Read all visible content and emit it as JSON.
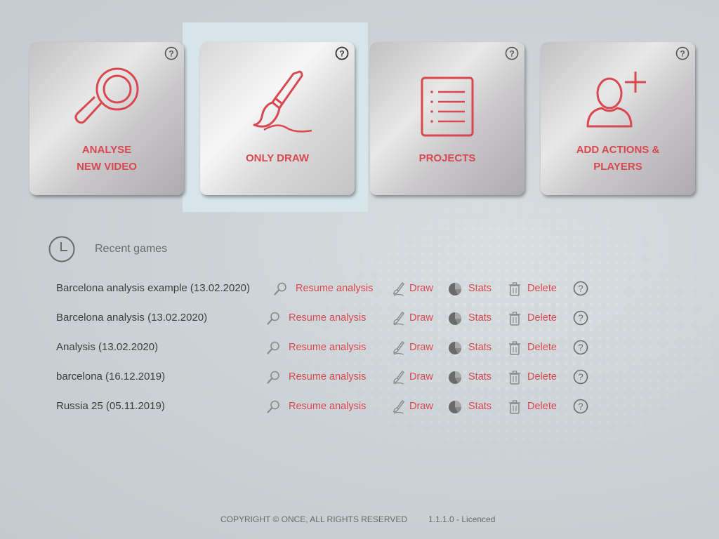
{
  "tiles": [
    {
      "label": "ANALYSE\nNEW VIDEO",
      "icon": "magnifier-icon"
    },
    {
      "label": "ONLY DRAW",
      "icon": "paintbrush-icon"
    },
    {
      "label": "PROJECTS",
      "icon": "list-document-icon"
    },
    {
      "label": "ADD ACTIONS &\nPLAYERS",
      "icon": "add-user-icon"
    }
  ],
  "recent": {
    "title": "Recent games",
    "games": [
      {
        "name": "Barcelona analysis example (13.02.2020)"
      },
      {
        "name": "Barcelona analysis (13.02.2020)"
      },
      {
        "name": "Analysis (13.02.2020)"
      },
      {
        "name": "barcelona (16.12.2019)"
      },
      {
        "name": "Russia 25 (05.11.2019)"
      }
    ],
    "actions": {
      "resume": "Resume analysis",
      "draw": "Draw",
      "stats": "Stats",
      "delete": "Delete"
    }
  },
  "footer": {
    "copyright": "COPYRIGHT © ONCE, ALL RIGHTS RESERVED",
    "version": "1.1.1.0 - Licenced"
  },
  "colors": {
    "accent": "#d84850",
    "text": "#3d3d3d",
    "highlight": "#d7e4ea"
  }
}
